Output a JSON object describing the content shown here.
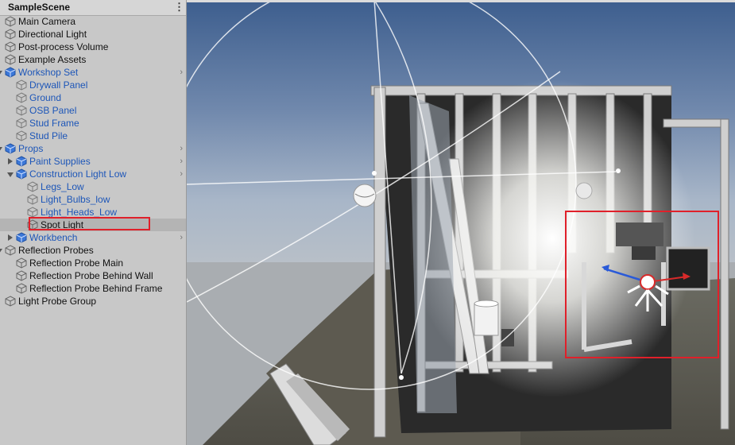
{
  "hierarchy": {
    "scene_name": "SampleScene",
    "menu_glyph": "⋮",
    "items": [
      {
        "label": "Main Camera",
        "depth": 0,
        "foldout": "none",
        "prefab": false
      },
      {
        "label": "Directional Light",
        "depth": 0,
        "foldout": "none",
        "prefab": false
      },
      {
        "label": "Post-process Volume",
        "depth": 0,
        "foldout": "none",
        "prefab": false
      },
      {
        "label": "Example Assets",
        "depth": 0,
        "foldout": "none",
        "prefab": false
      },
      {
        "label": "Workshop Set",
        "depth": 0,
        "foldout": "open",
        "prefab": true,
        "chevron": true
      },
      {
        "label": "Drywall Panel",
        "depth": 1,
        "foldout": "none",
        "prefab": true
      },
      {
        "label": "Ground",
        "depth": 1,
        "foldout": "none",
        "prefab": true
      },
      {
        "label": "OSB Panel",
        "depth": 1,
        "foldout": "none",
        "prefab": true
      },
      {
        "label": "Stud Frame",
        "depth": 1,
        "foldout": "none",
        "prefab": true
      },
      {
        "label": "Stud Pile",
        "depth": 1,
        "foldout": "none",
        "prefab": true
      },
      {
        "label": "Props",
        "depth": 0,
        "foldout": "open",
        "prefab": true,
        "chevron": true
      },
      {
        "label": "Paint Supplies",
        "depth": 1,
        "foldout": "closed",
        "prefab": true,
        "chevron": true
      },
      {
        "label": "Construction Light Low",
        "depth": 1,
        "foldout": "open",
        "prefab": true,
        "chevron": true
      },
      {
        "label": "Legs_Low",
        "depth": 2,
        "foldout": "none",
        "prefab": true
      },
      {
        "label": "Light_Bulbs_low",
        "depth": 2,
        "foldout": "none",
        "prefab": true
      },
      {
        "label": "Light_Heads_Low",
        "depth": 2,
        "foldout": "none",
        "prefab": true
      },
      {
        "label": "Spot Light",
        "depth": 2,
        "foldout": "none",
        "prefab": false,
        "selected": true
      },
      {
        "label": "Workbench",
        "depth": 1,
        "foldout": "closed",
        "prefab": true,
        "chevron": true
      },
      {
        "label": "Reflection Probes",
        "depth": 0,
        "foldout": "open",
        "prefab": false
      },
      {
        "label": "Reflection Probe Main",
        "depth": 1,
        "foldout": "none",
        "prefab": false
      },
      {
        "label": "Reflection Probe Behind Wall",
        "depth": 1,
        "foldout": "none",
        "prefab": false
      },
      {
        "label": "Reflection Probe Behind Frame",
        "depth": 1,
        "foldout": "none",
        "prefab": false
      },
      {
        "label": "Light Probe Group",
        "depth": 0,
        "foldout": "none",
        "prefab": false
      }
    ]
  },
  "colors": {
    "prefab_text": "#1d56b8",
    "highlight_red": "#e0202a",
    "selected_row": "#b4b4b4"
  },
  "icons": {
    "object": "cube-outline-icon",
    "prefab": "cube-blue-icon",
    "fold_open": "triangle-down-icon",
    "fold_closed": "triangle-right-icon",
    "chevron": "chevron-right-icon",
    "menu": "kebab-menu-icon"
  }
}
